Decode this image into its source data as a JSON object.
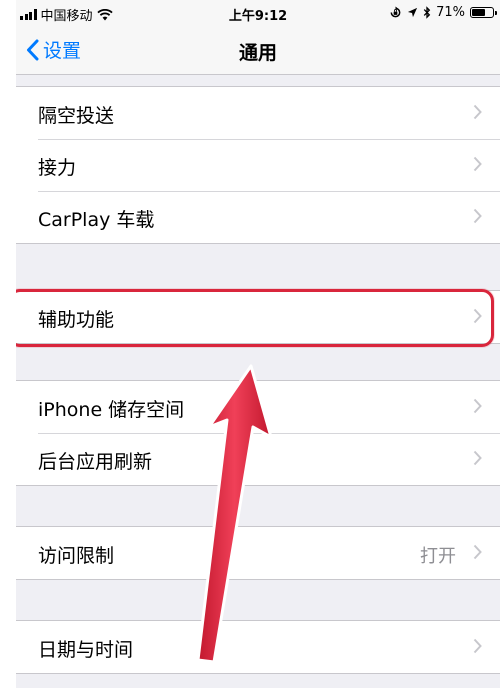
{
  "status_bar": {
    "carrier": "中国移动",
    "time": "上午9:12",
    "battery_text": "71%",
    "battery_level": 0.71
  },
  "nav": {
    "back_label": "设置",
    "title": "通用"
  },
  "groups": [
    {
      "items": [
        {
          "label": "隔空投送"
        },
        {
          "label": "接力"
        },
        {
          "label": "CarPlay 车载"
        }
      ]
    },
    {
      "items": [
        {
          "label": "辅助功能"
        }
      ]
    },
    {
      "items": [
        {
          "label": "iPhone 储存空间"
        },
        {
          "label": "后台应用刷新"
        }
      ]
    },
    {
      "items": [
        {
          "label": "访问限制",
          "value": "打开"
        }
      ]
    },
    {
      "items": [
        {
          "label": "日期与时间"
        }
      ]
    }
  ],
  "colors": {
    "accent": "#007aff",
    "highlight": "#d9263c",
    "background": "#efeff4"
  }
}
